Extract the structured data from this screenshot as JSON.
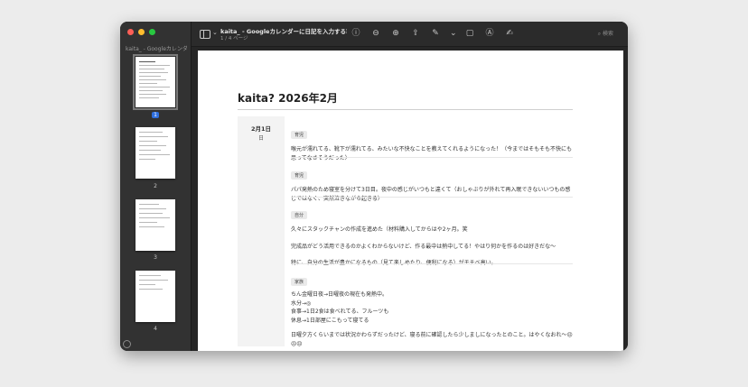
{
  "window": {
    "doc_title": "kaita_ - Googleカレンダーに日記を入力する専用ア…",
    "page_info": "1 / 4 ページ",
    "search_placeholder": "検索"
  },
  "sidebar": {
    "title": "kaita_ - Googleカレンダー",
    "pages": [
      {
        "label": "1",
        "selected": true
      },
      {
        "label": "2"
      },
      {
        "label": "3"
      },
      {
        "label": "4"
      }
    ]
  },
  "document": {
    "heading": "kaita? 2026年2月",
    "date": "2月1日",
    "weekday": "日",
    "entries": [
      {
        "tag": "育児",
        "text": "喉元が濡れてる、靴下が濡れてる、みたいな不快なことを教えてくれるようになった！（今まではそもそも不快にも思ってなさそうだった）"
      },
      {
        "tag": "育児",
        "text": "パパ発熱のため寝室を分けて3日目。夜中の感じがいつもと違くて（おしゃぶりが外れて再入眠できないいつもの感じではなく、突然泣きながら起きる）"
      },
      {
        "tag": "自分",
        "text": "久々にスタックチャンの作成を進めた（材料購入してからはや2ヶ月。笑"
      },
      {
        "tag": "",
        "text": "完成品がどう活用できるのかよくわからないけど、作る最中は熱中してる！やはり何かを作るのは好きだな〜"
      },
      {
        "tag": "",
        "text": "特に、自分の生活が豊かになるもの（見て楽しめたり、便利になる）がモチベ高い。"
      },
      {
        "tag": "家族",
        "text": "ちん金曜日夜→日曜夜の現在も発熱中。"
      },
      {
        "tag": "",
        "text": "水分→◎"
      },
      {
        "tag": "",
        "text": "食事→1日2食は食べれてる、フルーツも"
      },
      {
        "tag": "",
        "text": "休息→1日部屋にこもって寝てる"
      },
      {
        "tag": "",
        "text": "日曜夕方くらいまでは状況かわらずだったけど、寝る前に確認したら少しましになったとのこと。はやくなおれ〜😣😣😣"
      }
    ]
  }
}
